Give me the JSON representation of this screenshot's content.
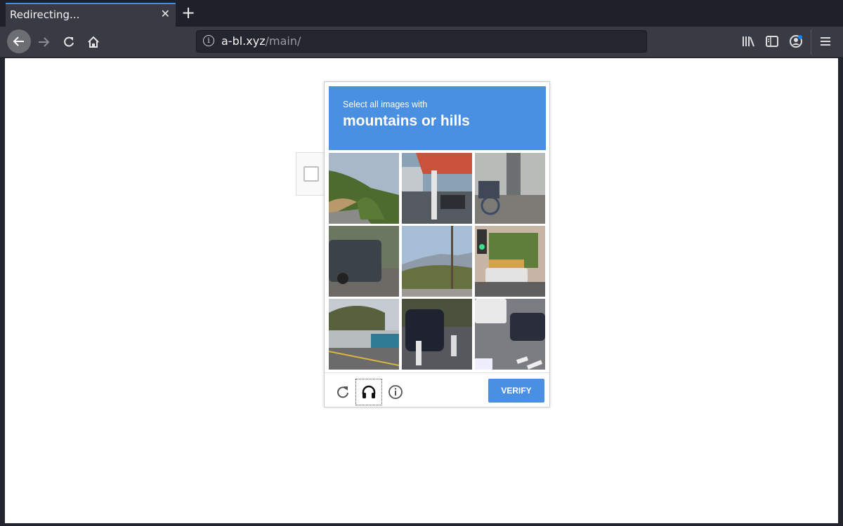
{
  "browser": {
    "tab": {
      "title": "Redirecting...",
      "close_icon": "close-icon"
    },
    "new_tab_icon": "plus-icon",
    "nav": {
      "back_icon": "arrow-left-icon",
      "forward_icon": "arrow-right-icon",
      "reload_icon": "reload-icon",
      "home_icon": "home-icon"
    },
    "url": {
      "host": "a-bl.xyz",
      "path": "/main/",
      "info_icon": "info-icon"
    },
    "toolbar": [
      "library-icon",
      "sidebar-icon",
      "account-icon",
      "menu-icon"
    ],
    "accent": "#3a8ee6"
  },
  "captcha": {
    "prompt_sub": "Select all images with",
    "prompt_main": "mountains or hills",
    "header_color": "#4a90e2",
    "tiles": [
      {
        "desc": "hillside with trees and road"
      },
      {
        "desc": "gas station canopy"
      },
      {
        "desc": "bicycle by building steps"
      },
      {
        "desc": "dark SUV parked"
      },
      {
        "desc": "distant mountains and shrubs"
      },
      {
        "desc": "traffic light and white car"
      },
      {
        "desc": "hills behind concrete barrier"
      },
      {
        "desc": "parked motorcycles"
      },
      {
        "desc": "van and scooters at crosswalk"
      }
    ],
    "footer": {
      "reload_icon": "reload-icon",
      "audio_icon": "headphones-icon",
      "info_icon": "info-icon",
      "verify_label": "VERIFY"
    }
  }
}
